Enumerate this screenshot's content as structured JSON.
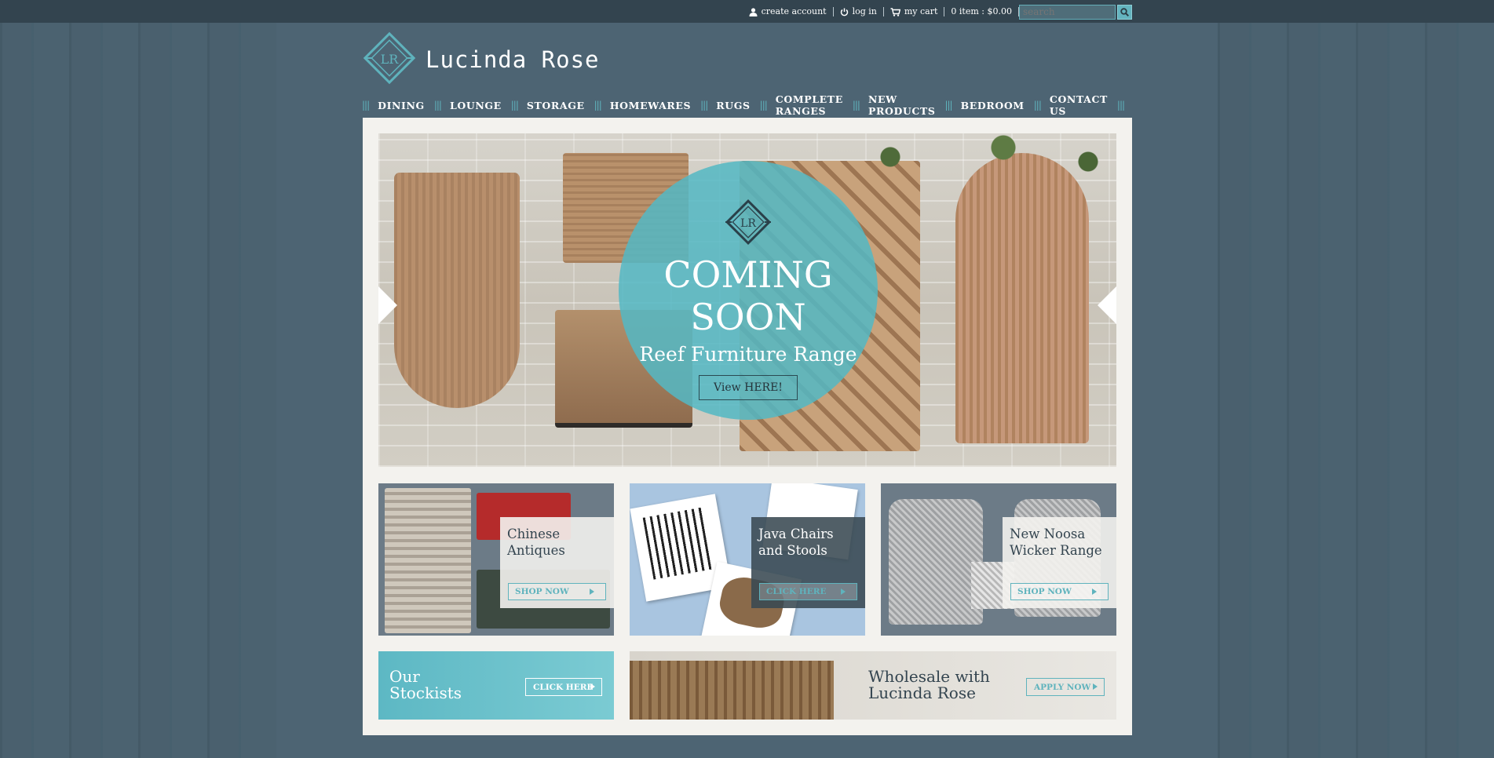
{
  "topbar": {
    "create_account": "create account",
    "log_in": "log in",
    "my_cart": "my cart",
    "cart_summary": "0 item : $0.00",
    "search_placeholder": "search"
  },
  "brand": {
    "name": "Lucinda Rose",
    "monogram": "LR"
  },
  "nav": {
    "items": [
      "DINING",
      "LOUNGE",
      "STORAGE",
      "HOMEWARES",
      "RUGS",
      "COMPLETE RANGES",
      "NEW PRODUCTS",
      "BEDROOM",
      "CONTACT US"
    ]
  },
  "hero": {
    "title_line1": "COMING",
    "title_line2": "SOON",
    "subtitle": "Reef Furniture Range",
    "button": "View HERE!"
  },
  "tiles": [
    {
      "title_line1": "Chinese",
      "title_line2": "Antiques",
      "button": "SHOP NOW"
    },
    {
      "title_line1": "Java Chairs",
      "title_line2": "and Stools",
      "button": "CLICK HERE"
    },
    {
      "title_line1": "New Noosa",
      "title_line2": "Wicker Range",
      "button": "SHOP NOW"
    }
  ],
  "banners": {
    "stockists": {
      "title_line1": "Our",
      "title_line2": "Stockists",
      "button": "CLICK HERE"
    },
    "wholesale": {
      "title_line1": "Wholesale with",
      "title_line2": "Lucinda Rose",
      "button": "APPLY NOW"
    }
  },
  "colors": {
    "background": "#4d6473",
    "topbar": "#33444f",
    "accent_teal": "#5fb3bd",
    "panel": "#f3f2ee"
  }
}
